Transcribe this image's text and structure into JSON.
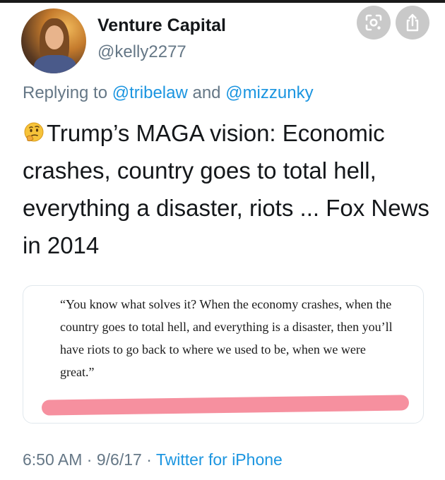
{
  "account": {
    "display_name": "Venture Capital",
    "handle": "@kelly2277"
  },
  "reply": {
    "prefix": "Replying to",
    "mention1": "@tribelaw",
    "conjunction": "and",
    "mention2": "@mizzunky"
  },
  "tweet": {
    "emoji": "thinking-face",
    "text": "Trump’s MAGA vision: Economic crashes, country goes to total hell, everything a disaster, riots ... Fox News in 2014"
  },
  "card": {
    "quote": "“You know what solves it? When the economy crashes, when the country goes to total hell, and everything is a disaster, then you’ll have riots to go back to where we used to be, when we were great.”",
    "highlight_color": "#f58a9a"
  },
  "meta": {
    "time": "6:50 AM",
    "separator": "·",
    "date": "9/6/17",
    "source": "Twitter for iPhone"
  },
  "colors": {
    "link": "#1b95e0",
    "secondary_text": "#657786",
    "primary_text": "#14171a"
  },
  "icons": [
    "google-lens-icon",
    "share-icon"
  ]
}
